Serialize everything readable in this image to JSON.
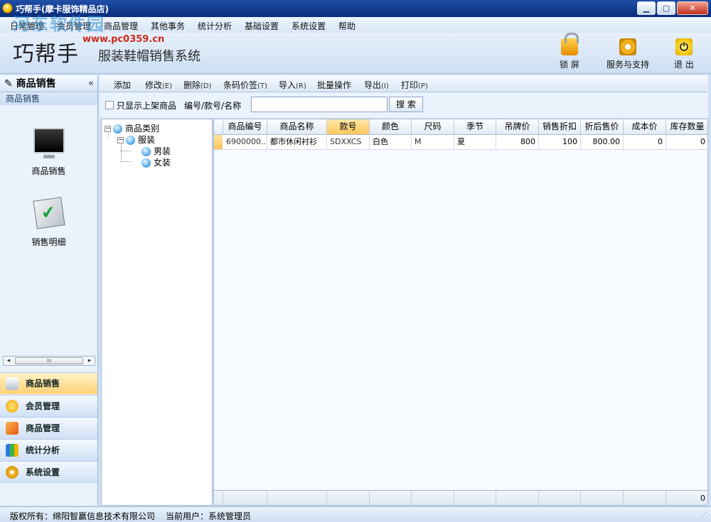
{
  "window": {
    "title": "巧帮手(摩卡服饰精品店)"
  },
  "menu": [
    "日常管理",
    "会员管理",
    "商品管理",
    "其他事务",
    "统计分析",
    "基础设置",
    "系统设置",
    "帮助"
  ],
  "brand": {
    "logo": "巧帮手",
    "subtitle": "服装鞋帽销售系统",
    "watermark": "河东软件园",
    "watermark_url": "www.pc0359.cn"
  },
  "header_tools": {
    "lock": "锁 屏",
    "service": "服务与支持",
    "exit": "退 出"
  },
  "left_panel": {
    "title": "商品销售",
    "collapse": "«",
    "section": "商品销售",
    "tiles": [
      "商品销售",
      "销售明细"
    ],
    "modules": [
      "商品销售",
      "会员管理",
      "商品管理",
      "统计分析",
      "系统设置"
    ]
  },
  "toolbar": [
    {
      "label": "添加",
      "key": ""
    },
    {
      "label": "修改",
      "key": "(E)"
    },
    {
      "label": "删除",
      "key": "(D)"
    },
    {
      "label": "条码价签",
      "key": "(T)"
    },
    {
      "label": "导入",
      "key": "(R)"
    },
    {
      "label": "批量操作",
      "key": ""
    },
    {
      "label": "导出",
      "key": "(I)"
    },
    {
      "label": "打印",
      "key": "(P)"
    }
  ],
  "search": {
    "only_on_shelf": "只显示上架商品",
    "label": "编号/款号/名称",
    "value": "",
    "button": "搜 索"
  },
  "tree": {
    "root": "商品类别",
    "child": "服装",
    "leaves": [
      "男装",
      "女装"
    ]
  },
  "grid": {
    "columns": [
      "商品编号",
      "商品名称",
      "款号",
      "颜色",
      "尺码",
      "季节",
      "吊牌价",
      "销售折扣",
      "折后售价",
      "成本价",
      "库存数量"
    ],
    "rows": [
      [
        "6900000...",
        "都市休闲衬衫",
        "SDXXCS",
        "白色",
        "M",
        "夏",
        "800",
        "100",
        "800.00",
        "0",
        "0"
      ]
    ],
    "footer_total": "0"
  },
  "status": {
    "copyright": "版权所有：绵阳智赢信息技术有限公司",
    "user": "当前用户：系统管理员"
  }
}
